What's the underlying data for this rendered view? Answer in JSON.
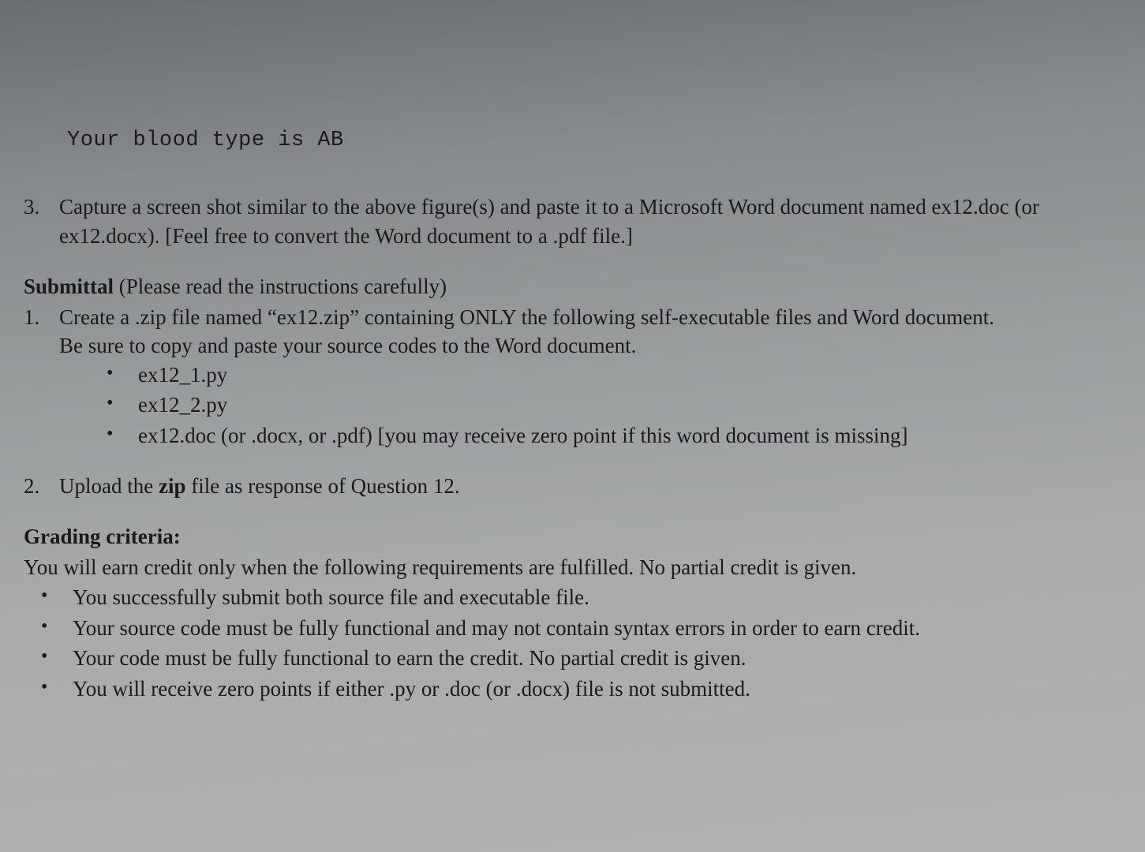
{
  "code_output": "Your blood type is AB",
  "step3": {
    "num": "3.",
    "text": "Capture a screen shot similar to the above figure(s) and paste it to a Microsoft Word document named ex12.doc (or ex12.docx). [Feel free to convert the Word document to a .pdf file.]"
  },
  "submittal": {
    "heading_bold": "Submittal",
    "heading_rest": " (Please read the instructions carefully)",
    "item1": {
      "num": "1.",
      "line1": "Create a .zip file named “ex12.zip” containing ONLY the following self-executable files and Word document.",
      "line2": "Be sure to copy and paste your source codes to the Word document.",
      "files": [
        "ex12_1.py",
        "ex12_2.py",
        "ex12.doc (or .docx, or .pdf) [you may receive zero point if this word document is missing]"
      ]
    },
    "item2": {
      "num": "2.",
      "pre": "Upload the ",
      "bold": "zip",
      "post": " file as response of Question 12."
    }
  },
  "grading": {
    "heading": "Grading criteria:",
    "intro": "You will earn credit only when the following requirements are fulfilled. No partial credit is given.",
    "bullets": [
      "You successfully submit both source file and executable file.",
      "Your source code must be fully functional and may not contain syntax errors in order to earn credit.",
      "Your code must be fully functional to earn the credit. No partial credit is given.",
      "You will receive zero points if either .py or .doc (or .docx) file is not submitted."
    ]
  }
}
